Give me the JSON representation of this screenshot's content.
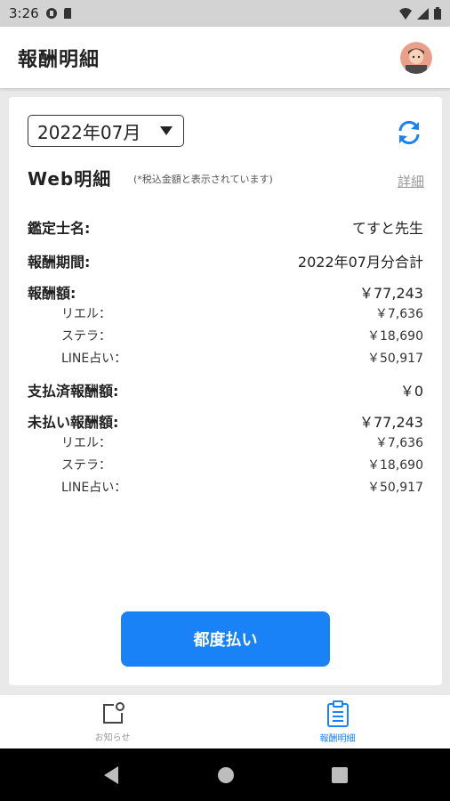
{
  "status_bar": {
    "time": "3:26"
  },
  "app_bar": {
    "title": "報酬明細"
  },
  "month_select": {
    "value": "2022年07月"
  },
  "web_statement": {
    "title": "Web明細",
    "note": "(*税込金額と表示されています)",
    "detail_link": "詳細"
  },
  "rows": {
    "appraiser": {
      "label": "鑑定士名:",
      "value": "てすと先生"
    },
    "period": {
      "label": "報酬期間:",
      "value": "2022年07月分合計"
    },
    "reward": {
      "label": "報酬額:",
      "value": "￥77,243",
      "items": [
        {
          "label": "リエル：",
          "value": "￥7,636"
        },
        {
          "label": "ステラ：",
          "value": "￥18,690"
        },
        {
          "label": "LINE占い：",
          "value": "￥50,917"
        }
      ]
    },
    "paid": {
      "label": "支払済報酬額:",
      "value": "￥0"
    },
    "unpaid": {
      "label": "未払い報酬額:",
      "value": "￥77,243",
      "items": [
        {
          "label": "リエル：",
          "value": "￥7,636"
        },
        {
          "label": "ステラ：",
          "value": "￥18,690"
        },
        {
          "label": "LINE占い：",
          "value": "￥50,917"
        }
      ]
    }
  },
  "pay_button": {
    "label": "都度払い"
  },
  "bottom_nav": {
    "items": [
      {
        "label": "お知らせ",
        "icon": "notification-icon",
        "active": false
      },
      {
        "label": "報酬明細",
        "icon": "clipboard-icon",
        "active": true
      }
    ]
  },
  "colors": {
    "accent": "#1a82f7",
    "inactive": "#999999"
  }
}
